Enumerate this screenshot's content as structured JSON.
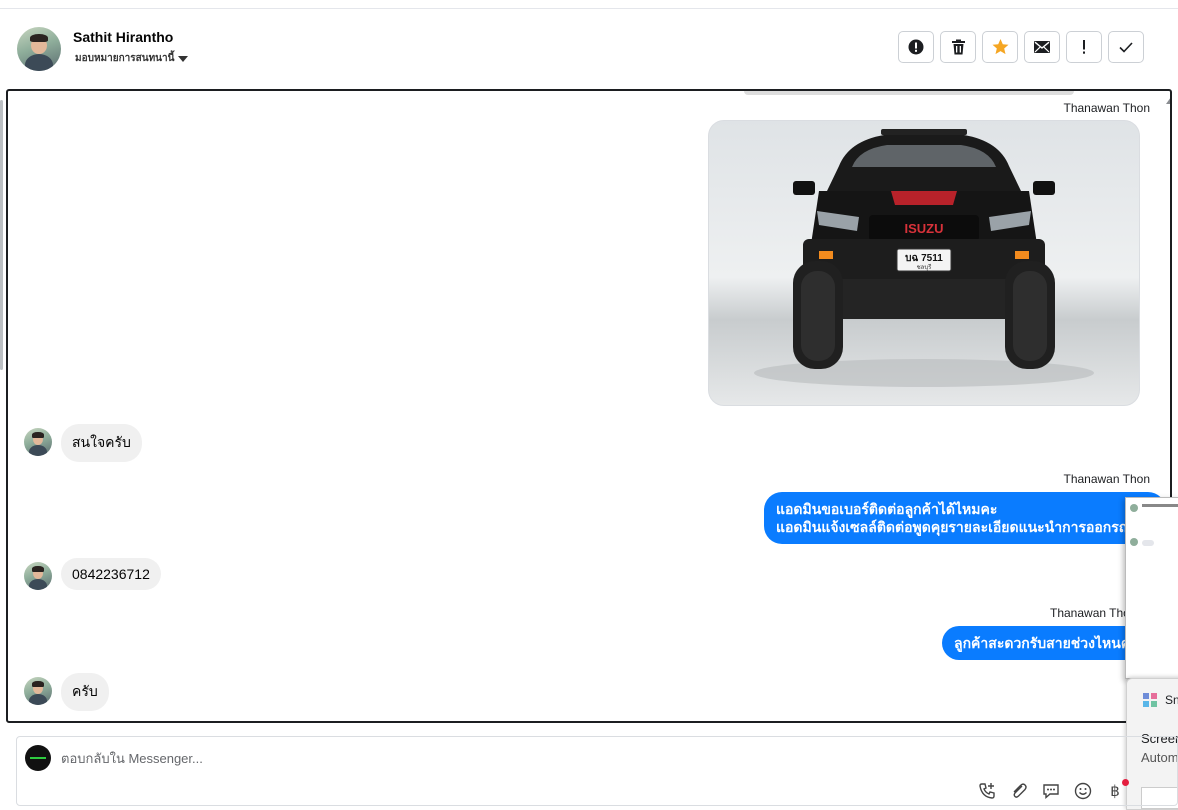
{
  "header": {
    "contact_name": "Sathit Hirantho",
    "assign_label": "มอบหมายการสนทนานี้",
    "toolbar": [
      {
        "name": "spam-button",
        "icon": "alert-circle-icon"
      },
      {
        "name": "delete-button",
        "icon": "trash-icon"
      },
      {
        "name": "star-button",
        "icon": "star-icon",
        "color": "#f5a623"
      },
      {
        "name": "mark-unread-button",
        "icon": "envelope-icon"
      },
      {
        "name": "follow-up-button",
        "icon": "exclamation-icon"
      },
      {
        "name": "done-button",
        "icon": "check-icon"
      }
    ]
  },
  "messages": [
    {
      "type": "outgoing-image",
      "sender": "Thanawan Thon",
      "image": "isuzu-pickup-photo"
    },
    {
      "type": "incoming",
      "text": "สนใจครับ"
    },
    {
      "type": "outgoing",
      "sender": "Thanawan Thon",
      "lines": [
        "แอดมินขอเบอร์ติดต่อลูกค้าได้ไหมคะ",
        "แอดมินแจ้งเซลล์ติดต่อพูดคุยรายละเอียดแนะนำการออกรถค่ะ"
      ]
    },
    {
      "type": "incoming",
      "text": "0842236712"
    },
    {
      "type": "outgoing",
      "sender": "Thanawan Thon",
      "lines": [
        "ลูกค้าสะดวกรับสายช่วงไหนคะ"
      ]
    },
    {
      "type": "incoming",
      "text": "ครับ"
    }
  ],
  "photo": {
    "plate_line1": "บฉ 7511",
    "plate_line2": "ชลบุรี",
    "brand_text": "ISUZU"
  },
  "toast": {
    "app": "Sn",
    "line1": "Screen",
    "line2": "Autom"
  },
  "composer": {
    "placeholder": "ตอบกลับใน Messenger...",
    "icons": [
      "phone-plus-icon",
      "paperclip-icon",
      "chat-bubble-icon",
      "emoji-icon",
      "baht-icon"
    ]
  },
  "colors": {
    "outgoing_bubble": "#0a7cff",
    "incoming_bubble": "#f0f0f0",
    "star": "#f5a623"
  }
}
